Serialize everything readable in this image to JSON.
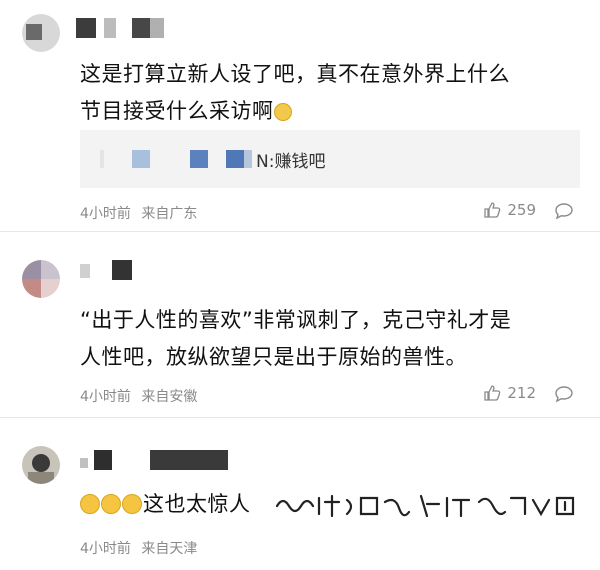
{
  "comments": [
    {
      "content_line1": "这是打算立新人设了吧，真不在意外界上什么",
      "content_line2": "节目接受什么采访啊",
      "quote_text": "N:赚钱吧",
      "time": "4小时前",
      "source": "来自广东",
      "likes": "259"
    },
    {
      "content_line1": "“出于人性的喜欢”非常讽刺了，克己守礼才是",
      "content_line2": "人性吧，放纵欲望只是出于原始的兽性。",
      "time": "4小时前",
      "source": "来自安徽",
      "likes": "212"
    },
    {
      "content": "这也太惊人",
      "time": "4小时前",
      "source": "来自天津"
    }
  ],
  "icons": {
    "like": "thumbs-up-icon",
    "reply": "speech-bubble-icon",
    "emoji": "grinning-face-icon"
  },
  "colors": {
    "accent_blue": "#4a78c2",
    "meta_gray": "#8a8a8a",
    "quote_bg": "#f3f3f3"
  }
}
